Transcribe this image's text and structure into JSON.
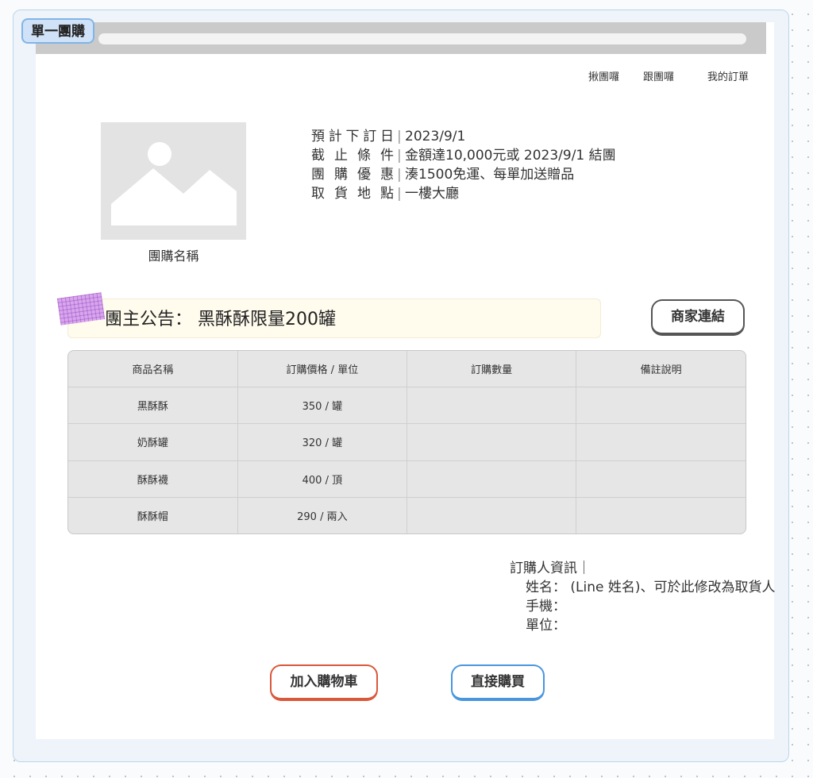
{
  "frame": {
    "label": "單一團購"
  },
  "nav": {
    "items": [
      "揪團囉",
      "跟團囉",
      "我的訂單"
    ]
  },
  "product": {
    "name": "團購名稱"
  },
  "info": {
    "rows": [
      {
        "label": "預計下訂日",
        "sep": "|",
        "value": "2023/9/1"
      },
      {
        "label": "截止條件",
        "sep": "|",
        "value": "金額達10,000元或 2023/9/1 結團"
      },
      {
        "label": "團購優惠",
        "sep": "|",
        "value": "湊1500免運、每單加送贈品"
      },
      {
        "label": "取貨地點",
        "sep": "|",
        "value": "一樓大廳"
      }
    ]
  },
  "notice": {
    "text": "團主公告： 黑酥酥限量200罐"
  },
  "buttons": {
    "merchant": "商家連結",
    "cart": "加入購物車",
    "buy": "直接購買"
  },
  "table": {
    "headers": [
      "商品名稱",
      "訂購價格 / 單位",
      "訂購數量",
      "備註說明"
    ],
    "rows": [
      [
        "黑酥酥",
        "350 / 罐",
        "",
        ""
      ],
      [
        "奶酥罐",
        "320 / 罐",
        "",
        ""
      ],
      [
        "酥酥襪",
        "400 / 頂",
        "",
        ""
      ],
      [
        "酥酥帽",
        "290 / 兩入",
        "",
        ""
      ]
    ]
  },
  "buyer": {
    "title": "訂購人資訊｜",
    "name_line": "姓名： (Line 姓名)、可於此修改為取貨人",
    "phone_line": "手機：",
    "unit_line": "單位："
  },
  "colors": {
    "cart_accent": "#d9583a",
    "buy_accent": "#4a96de",
    "tag_bg": "#cfe2f7"
  }
}
